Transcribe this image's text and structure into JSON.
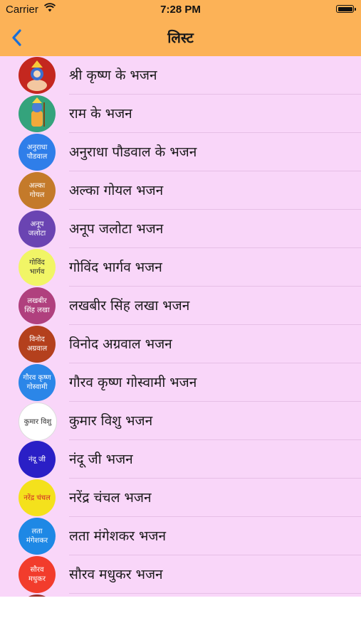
{
  "status_bar": {
    "carrier": "Carrier",
    "time": "7:28 PM"
  },
  "nav": {
    "title": "लिस्ट",
    "back_icon": "chevron-left-icon"
  },
  "accent_color": "#1a6fd6",
  "items": [
    {
      "avatar_text": "",
      "avatar_color": "#c4271f",
      "avatar_kind": "krishna-image",
      "label": "श्री कृष्ण के भजन"
    },
    {
      "avatar_text": "",
      "avatar_color": "#34a37c",
      "avatar_kind": "ram-image",
      "label": "राम के भजन"
    },
    {
      "avatar_text": "अनुराधा पौडवाल",
      "avatar_color": "#2f7ee9",
      "label": "अनुराधा पौडवाल के भजन"
    },
    {
      "avatar_text": "अल्का गोयल",
      "avatar_color": "#c47a2a",
      "label": "अल्का गोयल भजन"
    },
    {
      "avatar_text": "अनूप जलोटा",
      "avatar_color": "#6a44b2",
      "label": "अनूप जलोटा भजन"
    },
    {
      "avatar_text": "गोविंद भार्गव",
      "avatar_color": "#f1f566",
      "avatar_text_color": "#333333",
      "label": "गोविंद भार्गव भजन"
    },
    {
      "avatar_text": "लखबीर सिंह लखा",
      "avatar_color": "#b0407e",
      "label": "लखबीर सिंह लखा भजन"
    },
    {
      "avatar_text": "विनोद अग्रवाल",
      "avatar_color": "#b4401d",
      "label": "विनोद अग्रवाल भजन"
    },
    {
      "avatar_text": "गौरव कृष्ण गोस्वामी",
      "avatar_color": "#2b86e8",
      "label": "गौरव कृष्ण गोस्वामी भजन"
    },
    {
      "avatar_text": "कुमार विशु",
      "avatar_color": "#ffffff",
      "avatar_text_color": "#333333",
      "label": "कुमार विशु भजन"
    },
    {
      "avatar_text": "नंदू जी",
      "avatar_color": "#2a1fc6",
      "label": "नंदू जी भजन"
    },
    {
      "avatar_text": "नरेंद्र चंचल",
      "avatar_color": "#f4e11c",
      "avatar_text_color": "#d22a2a",
      "label": "नरेंद्र चंचल भजन"
    },
    {
      "avatar_text": "लता मंगेशकर",
      "avatar_color": "#1e88e5",
      "label": "लता मंगेशकर भजन"
    },
    {
      "avatar_text": "सौरव मधुकर",
      "avatar_color": "#f23c2c",
      "label": "सौरव मधुकर भजन"
    },
    {
      "avatar_text": "",
      "avatar_color": "#9a2f2a",
      "label": ""
    }
  ]
}
